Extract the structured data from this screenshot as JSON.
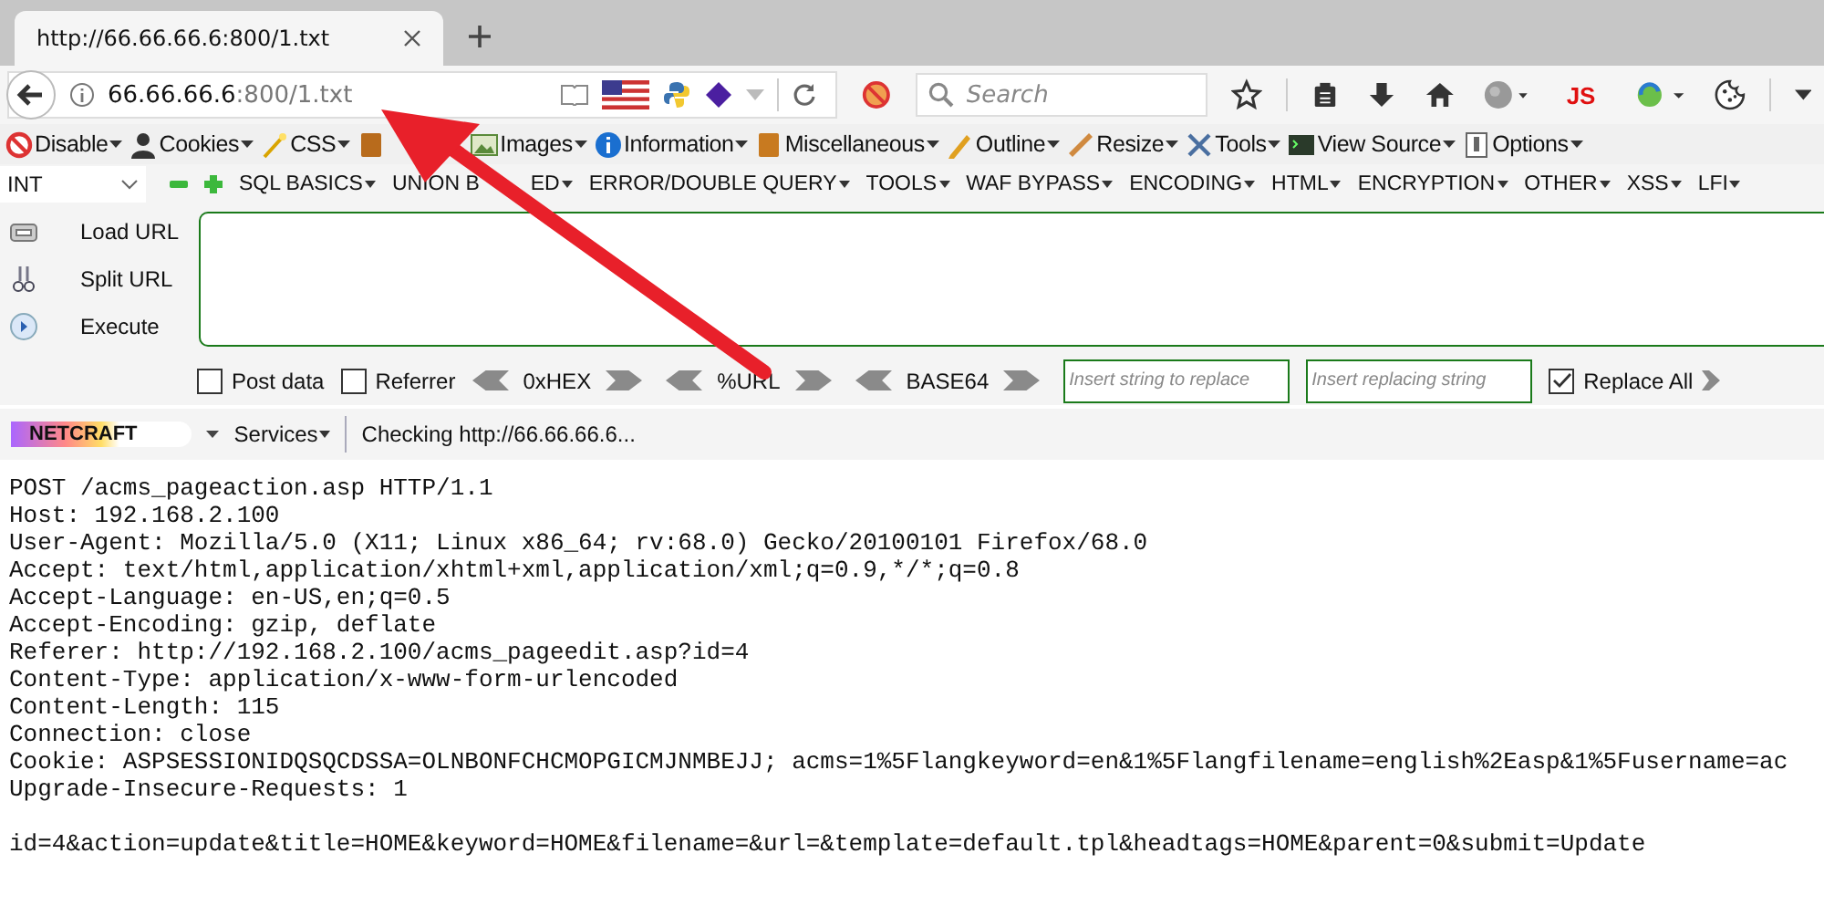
{
  "tab": {
    "title": "http://66.66.66.6:800/1.txt"
  },
  "address": {
    "host": "66.66.66.6",
    "path": ":800/1.txt"
  },
  "search": {
    "placeholder": "Search"
  },
  "js_label": "JS",
  "webdev_menu": [
    {
      "kind": "menu",
      "label": "Disable"
    },
    {
      "kind": "menu",
      "label": "Cookies"
    },
    {
      "kind": "menu",
      "label": "CSS"
    },
    {
      "kind": "covered"
    },
    {
      "kind": "menu",
      "label": "Images"
    },
    {
      "kind": "menu",
      "label": "Information"
    },
    {
      "kind": "menu",
      "label": "Miscellaneous"
    },
    {
      "kind": "menu",
      "label": "Outline"
    },
    {
      "kind": "menu",
      "label": "Resize"
    },
    {
      "kind": "menu",
      "label": "Tools"
    },
    {
      "kind": "menu",
      "label": "View Source"
    },
    {
      "kind": "menu",
      "label": "Options"
    }
  ],
  "hackbar": {
    "select": "INT",
    "menus": [
      {
        "label": "SQL BASICS"
      },
      {
        "label": "UNION B",
        "tail": "ED"
      },
      {
        "label": "ERROR/DOUBLE QUERY"
      },
      {
        "label": "TOOLS"
      },
      {
        "label": "WAF BYPASS"
      },
      {
        "label": "ENCODING"
      },
      {
        "label": "HTML"
      },
      {
        "label": "ENCRYPTION"
      },
      {
        "label": "OTHER"
      },
      {
        "label": "XSS"
      },
      {
        "label": "LFI"
      }
    ],
    "actions": [
      "Load URL",
      "Split URL",
      "Execute"
    ],
    "options": [
      {
        "kind": "checkbox",
        "label": "Post data",
        "checked": false
      },
      {
        "kind": "checkbox",
        "label": "Referrer",
        "checked": false
      },
      {
        "kind": "encoder",
        "label": "0xHEX"
      },
      {
        "kind": "encoder",
        "label": "%URL"
      },
      {
        "kind": "encoder",
        "label": "BASE64"
      },
      {
        "kind": "field",
        "placeholder": "Insert string to replace"
      },
      {
        "kind": "field",
        "placeholder": "Insert replacing string"
      },
      {
        "kind": "checkbox",
        "label": "Replace All",
        "checked": true
      },
      {
        "kind": "next"
      }
    ]
  },
  "netcraft": {
    "logo": "NETCRAFT",
    "services": "Services",
    "status": "Checking http://66.66.66.6..."
  },
  "request_headers": [
    "POST /acms_pageaction.asp HTTP/1.1",
    "Host: 192.168.2.100",
    "User-Agent: Mozilla/5.0 (X11; Linux x86_64; rv:68.0) Gecko/20100101 Firefox/68.0",
    "Accept: text/html,application/xhtml+xml,application/xml;q=0.9,*/*;q=0.8",
    "Accept-Language: en-US,en;q=0.5",
    "Accept-Encoding: gzip, deflate",
    "Referer: http://192.168.2.100/acms_pageedit.asp?id=4",
    "Content-Type: application/x-www-form-urlencoded",
    "Content-Length: 115",
    "Connection: close",
    "Cookie: ASPSESSIONIDQSQCDSSA=OLNBONFCHCMOPGICMJNMBEJJ; acms=1%5Flangkeyword=en&1%5Flangfilename=english%2Easp&1%5Fusername=ac",
    "Upgrade-Insecure-Requests: 1"
  ],
  "request_body": "id=4&action=update&title=HOME&keyword=HOME&filename=&url=&template=default.tpl&headtags=HOME&parent=0&submit=Update"
}
